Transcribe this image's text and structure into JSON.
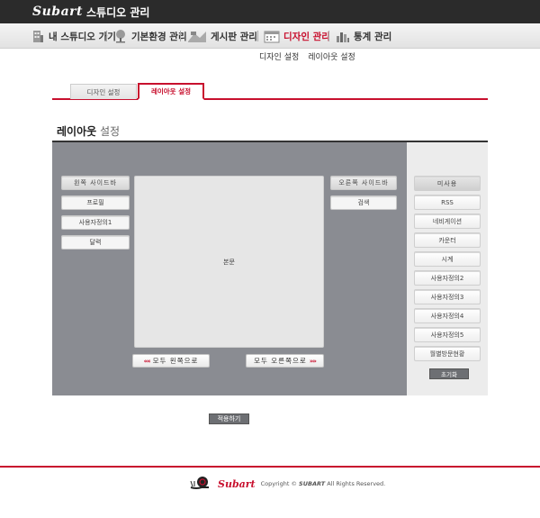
{
  "header": {
    "logo": "Subart",
    "title": "스튜디오 관리"
  },
  "nav": {
    "items": [
      {
        "label": "내 스튜디오 가기",
        "icon": "building-icon"
      },
      {
        "label": "기본환경 관리",
        "icon": "tree-icon"
      },
      {
        "label": "게시판 관리",
        "icon": "board-icon"
      },
      {
        "label": "디자인 관리",
        "icon": "calendar-icon",
        "active": true
      },
      {
        "label": "통계 관리",
        "icon": "chart-icon"
      }
    ]
  },
  "subnav": {
    "items": [
      "디자인 설정",
      "레이아웃 설정"
    ]
  },
  "tabs": {
    "inactive": "디자인 설정",
    "active": "레이아웃 설정"
  },
  "section": {
    "title_bold": "레이아웃",
    "title_light": "설정"
  },
  "layout": {
    "left_sidebar_header": "왼쪽 사이드바",
    "left_items": [
      "프로필",
      "사용자정의1",
      "달력"
    ],
    "right_sidebar_header": "오른쪽 사이드바",
    "right_items": [
      "검색"
    ],
    "body_label": "본문",
    "move_all_left": "모두 왼쪽으로",
    "move_all_right": "모두 오른쪽으로"
  },
  "unused": {
    "header": "미사용",
    "items": [
      "RSS",
      "네비게이션",
      "카운터",
      "시계",
      "사용자정의2",
      "사용자정의3",
      "사용자정의4",
      "사용자정의5",
      "월별방문현황"
    ],
    "reset_label": "초기화"
  },
  "apply_label": "적용하기",
  "footer": {
    "logo": "Subart",
    "copyright_prefix": "Copyright ©",
    "brand": "SUBART",
    "copyright_suffix": "All Rights Reserved."
  },
  "colors": {
    "accent": "#c8102e",
    "editor_bg": "#8a8c92",
    "topbar": "#2b2b2b"
  }
}
